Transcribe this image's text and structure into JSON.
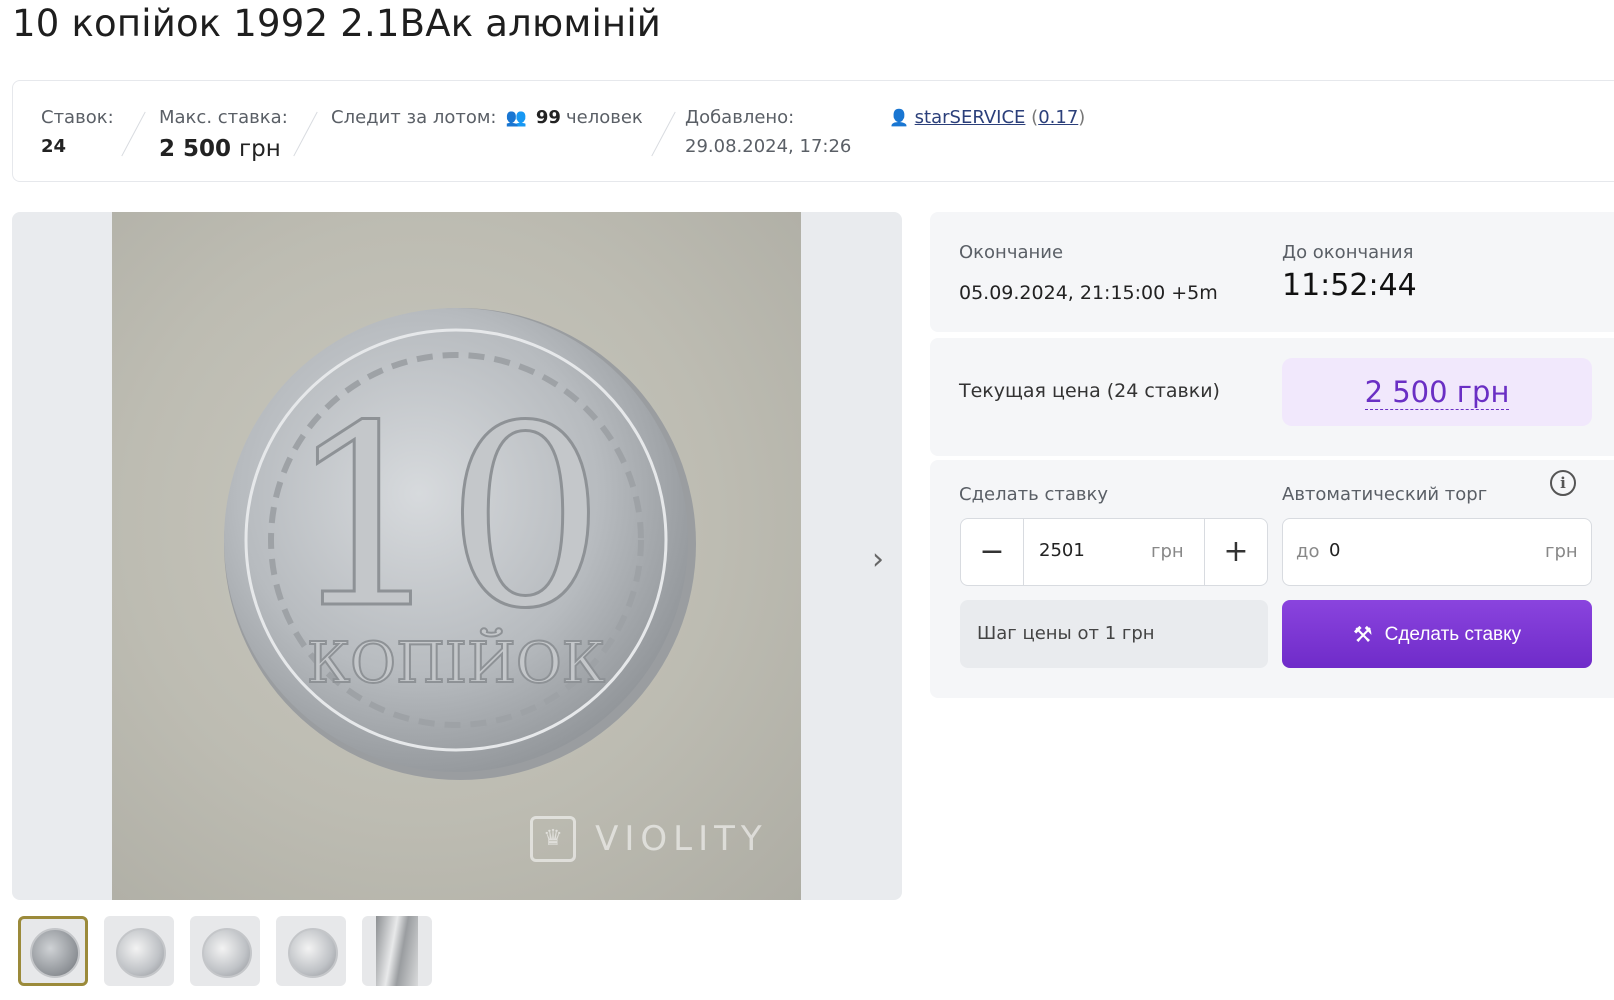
{
  "lot": {
    "title": "10 копійок 1992 2.1ВАк алюміній"
  },
  "info": {
    "bids_label": "Ставок:",
    "bids_value": "24",
    "max_bid_label": "Макс. ставка:",
    "max_bid_amount": "2 500",
    "max_bid_unit": "грн",
    "watching_label": "Следит за лотом:",
    "watching_count": "99",
    "watching_unit": "человек",
    "added_label": "Добавлено:",
    "added_value": "29.08.2024, 17:26",
    "seller_name": "starSERVICE",
    "seller_rating": "0.17"
  },
  "gallery": {
    "watermark": "VIOLITY",
    "coin_denomination": "10",
    "coin_word": "КОПІЙОК",
    "thumbnail_count": 5
  },
  "auction": {
    "end_label": "Окончание",
    "end_value": "05.09.2024, 21:15:00 +5m",
    "remaining_label": "До окончания",
    "remaining_value": "11:52:44",
    "current_price_label": "Текущая цена (24 ставки)",
    "current_price_value": "2 500 грн"
  },
  "bid_form": {
    "make_bid_label": "Сделать ставку",
    "auto_label": "Автоматический торг",
    "bid_value": "2501",
    "bid_unit": "грн",
    "auto_prefix": "до",
    "auto_value": "0",
    "auto_unit": "грн",
    "step_note": "Шаг цены от 1 грн",
    "submit_label": "Сделать ставку"
  },
  "colors": {
    "accent": "#7a36d4",
    "price_bg": "#f1e8fc",
    "rating": "#2e8b2e"
  }
}
